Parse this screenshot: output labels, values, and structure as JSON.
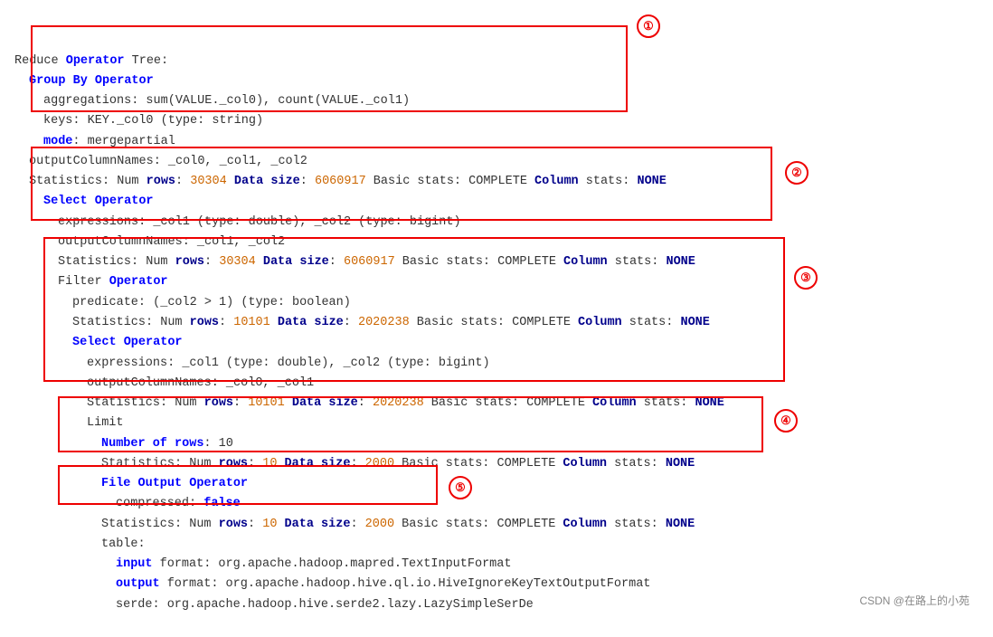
{
  "title": "Reduce Operator Tree",
  "watermark": "CSDN @在路上的小苑",
  "lines": [
    {
      "indent": 0,
      "parts": [
        {
          "text": "Reduce ",
          "style": "text-black"
        },
        {
          "text": "Operator",
          "style": "kw-blue"
        },
        {
          "text": " Tree:",
          "style": "text-black"
        }
      ]
    },
    {
      "indent": 1,
      "parts": [
        {
          "text": "Group By Operator",
          "style": "kw-blue",
          "bold": true
        }
      ]
    },
    {
      "indent": 2,
      "parts": [
        {
          "text": "aggregations: sum(VALUE._col0), count(VALUE._col1)",
          "style": "text-black"
        }
      ]
    },
    {
      "indent": 2,
      "parts": [
        {
          "text": "keys: KEY._col0 (type: string)",
          "style": "text-black"
        }
      ]
    },
    {
      "indent": 2,
      "parts": [
        {
          "text": "mode",
          "style": "kw-blue"
        },
        {
          "text": ": mergepartial",
          "style": "text-black"
        }
      ]
    },
    {
      "indent": 1,
      "parts": [
        {
          "text": "outputColumnNames: _col0, _col1, _col2",
          "style": "text-black"
        }
      ]
    },
    {
      "indent": 1,
      "parts": [
        {
          "text": "Statistics: Num ",
          "style": "text-black"
        },
        {
          "text": "rows",
          "style": "kw-darkblue"
        },
        {
          "text": ": ",
          "style": "text-black"
        },
        {
          "text": "30304",
          "style": "num-orange"
        },
        {
          "text": " ",
          "style": "text-black"
        },
        {
          "text": "Data size",
          "style": "kw-darkblue"
        },
        {
          "text": ": ",
          "style": "text-black"
        },
        {
          "text": "6060917",
          "style": "num-orange"
        },
        {
          "text": " Basic stats: COMPLETE ",
          "style": "text-black"
        },
        {
          "text": "Column",
          "style": "kw-darkblue"
        },
        {
          "text": " stats: ",
          "style": "text-black"
        },
        {
          "text": "NONE",
          "style": "kw-darkblue"
        }
      ]
    },
    {
      "indent": 2,
      "parts": [
        {
          "text": "Select",
          "style": "kw-blue"
        },
        {
          "text": " Operator",
          "style": "kw-blue"
        }
      ]
    },
    {
      "indent": 3,
      "parts": [
        {
          "text": "expressions: _col1 (type: double), _col2 (type: bigint)",
          "style": "text-black"
        }
      ]
    },
    {
      "indent": 3,
      "parts": [
        {
          "text": "outputColumnNames: _col1, _col2",
          "style": "text-black"
        }
      ]
    },
    {
      "indent": 3,
      "parts": [
        {
          "text": "Statistics: Num ",
          "style": "text-black"
        },
        {
          "text": "rows",
          "style": "kw-darkblue"
        },
        {
          "text": ": ",
          "style": "text-black"
        },
        {
          "text": "30304",
          "style": "num-orange"
        },
        {
          "text": " ",
          "style": "text-black"
        },
        {
          "text": "Data size",
          "style": "kw-darkblue"
        },
        {
          "text": ": ",
          "style": "text-black"
        },
        {
          "text": "6060917",
          "style": "num-orange"
        },
        {
          "text": " Basic stats: COMPLETE ",
          "style": "text-black"
        },
        {
          "text": "Column",
          "style": "kw-darkblue"
        },
        {
          "text": " stats: ",
          "style": "text-black"
        },
        {
          "text": "NONE",
          "style": "kw-darkblue"
        }
      ]
    },
    {
      "indent": 3,
      "parts": [
        {
          "text": "Filter ",
          "style": "text-black"
        },
        {
          "text": "Operator",
          "style": "kw-blue"
        }
      ]
    },
    {
      "indent": 4,
      "parts": [
        {
          "text": "predicate: (_col2 > 1) (type: boolean)",
          "style": "text-black"
        }
      ]
    },
    {
      "indent": 4,
      "parts": [
        {
          "text": "Statistics: Num ",
          "style": "text-black"
        },
        {
          "text": "rows",
          "style": "kw-darkblue"
        },
        {
          "text": ": ",
          "style": "text-black"
        },
        {
          "text": "10101",
          "style": "num-orange"
        },
        {
          "text": " ",
          "style": "text-black"
        },
        {
          "text": "Data size",
          "style": "kw-darkblue"
        },
        {
          "text": ": ",
          "style": "text-black"
        },
        {
          "text": "2020238",
          "style": "num-orange"
        },
        {
          "text": " Basic stats: COMPLETE ",
          "style": "text-black"
        },
        {
          "text": "Column",
          "style": "kw-darkblue"
        },
        {
          "text": " stats: ",
          "style": "text-black"
        },
        {
          "text": "NONE",
          "style": "kw-darkblue"
        }
      ]
    },
    {
      "indent": 4,
      "parts": [
        {
          "text": "Select",
          "style": "kw-blue"
        },
        {
          "text": " Operator",
          "style": "kw-blue"
        }
      ]
    },
    {
      "indent": 5,
      "parts": [
        {
          "text": "expressions: _col1 (type: double), _col2 (type: bigint)",
          "style": "text-black"
        }
      ]
    },
    {
      "indent": 5,
      "parts": [
        {
          "text": "outputColumnNames: _col0, _col1",
          "style": "text-black"
        }
      ]
    },
    {
      "indent": 5,
      "parts": [
        {
          "text": "Statistics: Num ",
          "style": "text-black"
        },
        {
          "text": "rows",
          "style": "kw-darkblue"
        },
        {
          "text": ": ",
          "style": "text-black"
        },
        {
          "text": "10101",
          "style": "num-orange"
        },
        {
          "text": " ",
          "style": "text-black"
        },
        {
          "text": "Data size",
          "style": "kw-darkblue"
        },
        {
          "text": ": ",
          "style": "text-black"
        },
        {
          "text": "2020238",
          "style": "num-orange"
        },
        {
          "text": " Basic stats: COMPLETE ",
          "style": "text-black"
        },
        {
          "text": "Column",
          "style": "kw-darkblue"
        },
        {
          "text": " stats: ",
          "style": "text-black"
        },
        {
          "text": "NONE",
          "style": "kw-darkblue"
        }
      ]
    },
    {
      "indent": 5,
      "parts": [
        {
          "text": "Limit",
          "style": "text-black"
        }
      ]
    },
    {
      "indent": 6,
      "parts": [
        {
          "text": "Number of rows",
          "style": "kw-blue"
        },
        {
          "text": ": 10",
          "style": "text-black"
        }
      ]
    },
    {
      "indent": 6,
      "parts": [
        {
          "text": "Statistics: Num ",
          "style": "text-black"
        },
        {
          "text": "rows",
          "style": "kw-darkblue"
        },
        {
          "text": ": ",
          "style": "text-black"
        },
        {
          "text": "10",
          "style": "num-orange"
        },
        {
          "text": " ",
          "style": "text-black"
        },
        {
          "text": "Data size",
          "style": "kw-darkblue"
        },
        {
          "text": ": ",
          "style": "text-black"
        },
        {
          "text": "2000",
          "style": "num-orange"
        },
        {
          "text": " Basic stats: COMPLETE ",
          "style": "text-black"
        },
        {
          "text": "Column",
          "style": "kw-darkblue"
        },
        {
          "text": " stats: ",
          "style": "text-black"
        },
        {
          "text": "NONE",
          "style": "kw-darkblue"
        }
      ]
    },
    {
      "indent": 6,
      "parts": [
        {
          "text": "File Output Operator",
          "style": "kw-blue"
        }
      ]
    },
    {
      "indent": 7,
      "parts": [
        {
          "text": "compressed: ",
          "style": "text-black"
        },
        {
          "text": "false",
          "style": "kw-blue"
        }
      ]
    },
    {
      "indent": 6,
      "parts": [
        {
          "text": "Statistics: Num ",
          "style": "text-black"
        },
        {
          "text": "rows",
          "style": "kw-darkblue"
        },
        {
          "text": ": ",
          "style": "text-black"
        },
        {
          "text": "10",
          "style": "num-orange"
        },
        {
          "text": " ",
          "style": "text-black"
        },
        {
          "text": "Data size",
          "style": "kw-darkblue"
        },
        {
          "text": ": ",
          "style": "text-black"
        },
        {
          "text": "2000",
          "style": "num-orange"
        },
        {
          "text": " Basic stats: COMPLETE ",
          "style": "text-black"
        },
        {
          "text": "Column",
          "style": "kw-darkblue"
        },
        {
          "text": " stats: ",
          "style": "text-black"
        },
        {
          "text": "NONE",
          "style": "kw-darkblue"
        }
      ]
    },
    {
      "indent": 6,
      "parts": [
        {
          "text": "table:",
          "style": "text-black"
        }
      ]
    },
    {
      "indent": 7,
      "parts": [
        {
          "text": "input",
          "style": "kw-blue"
        },
        {
          "text": " format: org.apache.hadoop.mapred.TextInputFormat",
          "style": "text-black"
        }
      ]
    },
    {
      "indent": 7,
      "parts": [
        {
          "text": "output",
          "style": "kw-blue"
        },
        {
          "text": " format: org.apache.hadoop.hive.ql.io.HiveIgnoreKeyTextOutputFormat",
          "style": "text-black"
        }
      ]
    },
    {
      "indent": 7,
      "parts": [
        {
          "text": "serde: org.apache.hadoop.hive.serde2.lazy.LazySimpleSerDe",
          "style": "text-black"
        }
      ]
    }
  ],
  "badges": [
    {
      "label": "①",
      "class": "badge1"
    },
    {
      "label": "②",
      "class": "badge2"
    },
    {
      "label": "③",
      "class": "badge3"
    },
    {
      "label": "④",
      "class": "badge4"
    },
    {
      "label": "⑤",
      "class": "badge5"
    }
  ]
}
